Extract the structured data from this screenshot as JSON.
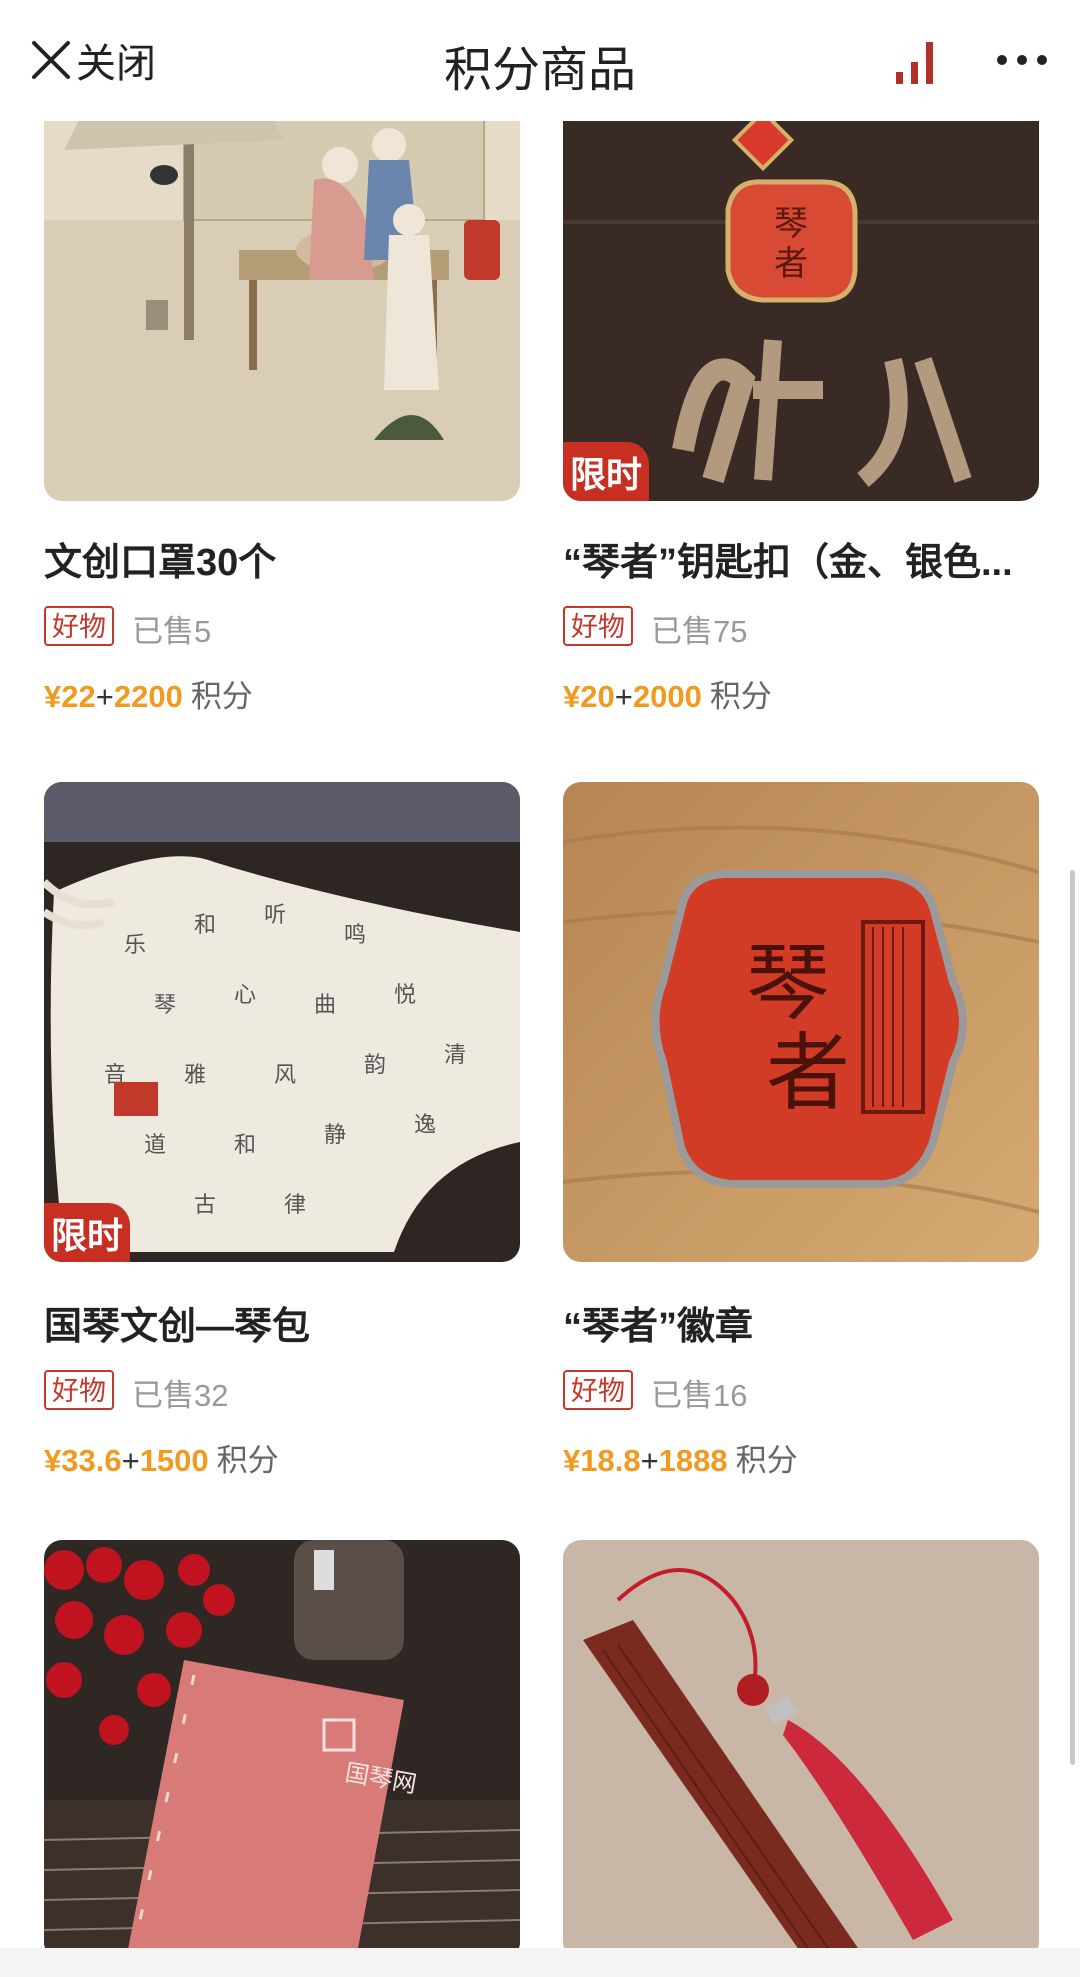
{
  "header": {
    "close_label": "关闭",
    "title": "积分商品"
  },
  "products": [
    {
      "name": "文创口罩30个",
      "tag": "好物",
      "sold": "已售5",
      "price_money": "¥22",
      "plus": "+",
      "price_points": "2200",
      "points_unit": "积分",
      "limited": ""
    },
    {
      "name": "“琴者”钥匙扣（金、银色...",
      "tag": "好物",
      "sold": "已售75",
      "price_money": "¥20",
      "plus": "+",
      "price_points": "2000",
      "points_unit": "积分",
      "limited": "限时"
    },
    {
      "name": "国琴文创—琴包",
      "tag": "好物",
      "sold": "已售32",
      "price_money": "¥33.6",
      "plus": "+",
      "price_points": "1500",
      "points_unit": "积分",
      "limited": "限时"
    },
    {
      "name": "“琴者”徽章",
      "tag": "好物",
      "sold": "已售16",
      "price_money": "¥18.8",
      "plus": "+",
      "price_points": "1888",
      "points_unit": "积分",
      "limited": ""
    }
  ],
  "image_text": {
    "keychain_char": "琴者",
    "badge_char": "琴者",
    "book_brand": "国琴网"
  },
  "colors": {
    "accent_red": "#c62f22",
    "price_orange": "#f29a1f",
    "stats_icon": "#b0312a"
  }
}
